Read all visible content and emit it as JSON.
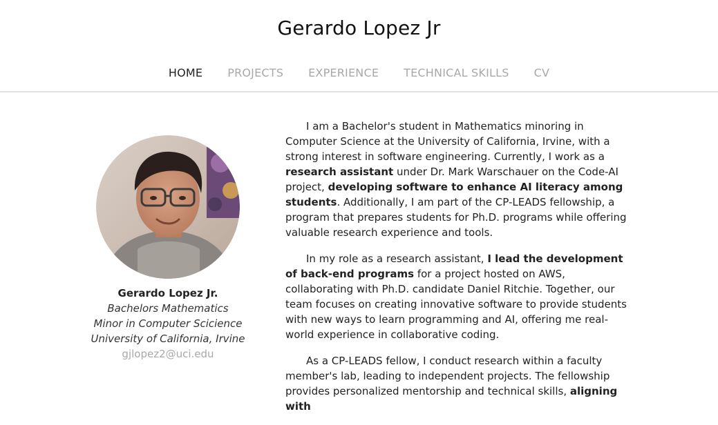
{
  "site": {
    "title": "Gerardo Lopez Jr"
  },
  "nav": {
    "items": [
      {
        "label": "HOME",
        "active": true
      },
      {
        "label": "PROJECTS",
        "active": false
      },
      {
        "label": "EXPERIENCE",
        "active": false
      },
      {
        "label": "TECHNICAL SKILLS",
        "active": false
      },
      {
        "label": "CV",
        "active": false
      }
    ]
  },
  "profile": {
    "name": "Gerardo Lopez Jr.",
    "degree": "Bachelors Mathematics",
    "minor": "Minor in Computer Scicience",
    "university": "University of California, Irvine",
    "email": "gjlopez2@uci.edu"
  },
  "bio": {
    "p1": {
      "a": "I am a Bachelor's student in Mathematics minoring in Computer Science at the University of California, Irvine, with a strong interest in software engineering. Currently, I work as a ",
      "b1": "research assistant",
      "c": " under Dr. Mark Warschauer on the Code-AI project, ",
      "b2": "developing software to enhance AI literacy among students",
      "d": ". Additionally, I am part of the CP-LEADS fellowship, a program that prepares students for Ph.D. programs while offering valuable research experience and tools."
    },
    "p2": {
      "a": "In my role as a research assistant, ",
      "b1": "I lead the development of back-end programs",
      "c": " for a project hosted on AWS, collaborating with Ph.D. candidate Daniel Ritchie. Together, our team focuses on creating innovative software to provide students with new ways to learn programming and AI, offering me real-world experience in collaborative coding."
    },
    "p3": {
      "a": "As a CP-LEADS fellow, I conduct research within a faculty member's lab, leading to independent projects. The fellowship provides personalized mentorship and technical skills, ",
      "b1": "aligning with"
    }
  }
}
